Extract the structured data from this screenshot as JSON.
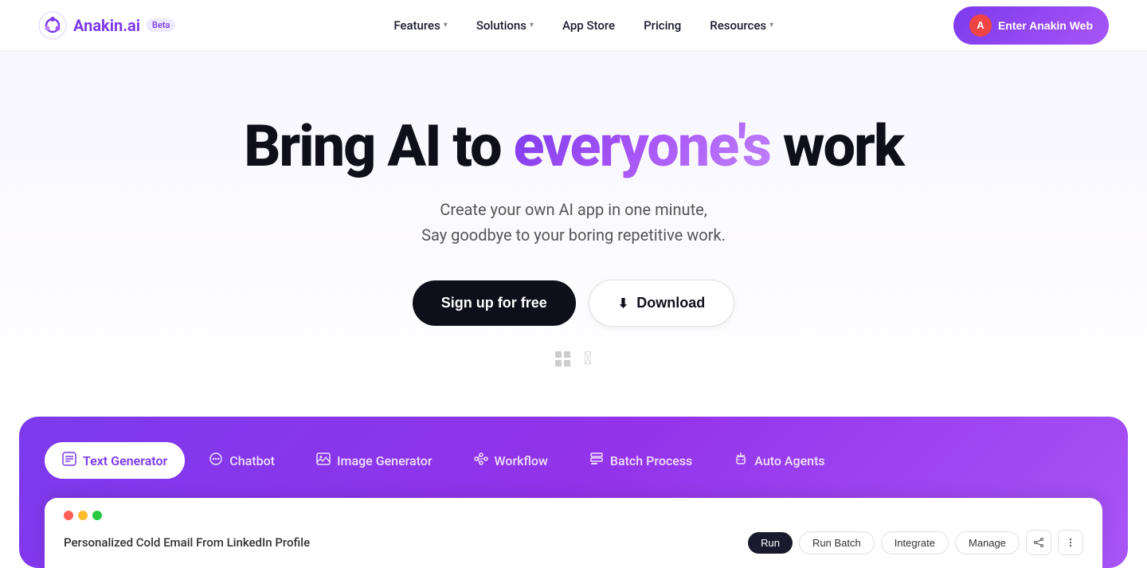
{
  "nav": {
    "logo_text": "Anakin",
    "logo_suffix": ".ai",
    "beta_label": "Beta",
    "links": [
      {
        "label": "Features",
        "has_dropdown": true
      },
      {
        "label": "Solutions",
        "has_dropdown": true
      },
      {
        "label": "App Store",
        "has_dropdown": false
      },
      {
        "label": "Pricing",
        "has_dropdown": false
      },
      {
        "label": "Resources",
        "has_dropdown": true
      }
    ],
    "cta_label": "Enter Anakin Web",
    "avatar_letter": "A"
  },
  "hero": {
    "title_pre": "Bring AI to ",
    "title_highlight": "everyone's",
    "title_post": " work",
    "subtitle_line1": "Create your own AI app in one minute,",
    "subtitle_line2": "Say goodbye to your boring repetitive work.",
    "btn_primary": "Sign up for free",
    "btn_secondary": "Download",
    "download_icon": "⬇"
  },
  "features": {
    "tabs": [
      {
        "id": "text-generator",
        "label": "Text Generator",
        "icon": "📝",
        "active": true
      },
      {
        "id": "chatbot",
        "label": "Chatbot",
        "icon": "💬",
        "active": false
      },
      {
        "id": "image-generator",
        "label": "Image Generator",
        "icon": "🖼",
        "active": false
      },
      {
        "id": "workflow",
        "label": "Workflow",
        "icon": "🔄",
        "active": false
      },
      {
        "id": "batch-process",
        "label": "Batch Process",
        "icon": "📋",
        "active": false
      },
      {
        "id": "auto-agents",
        "label": "Auto Agents",
        "icon": "🤖",
        "active": false
      }
    ]
  },
  "demo": {
    "window_title": "Personalized Cold Email From LinkedIn Profile",
    "action_run": "Run",
    "action_run_batch": "Run Batch",
    "action_integrate": "Integrate",
    "action_manage": "Manage"
  },
  "colors": {
    "purple": "#7c3aed",
    "dark": "#0f0f1a",
    "accent_gradient_start": "#7c3aed",
    "accent_gradient_end": "#a855f7"
  }
}
